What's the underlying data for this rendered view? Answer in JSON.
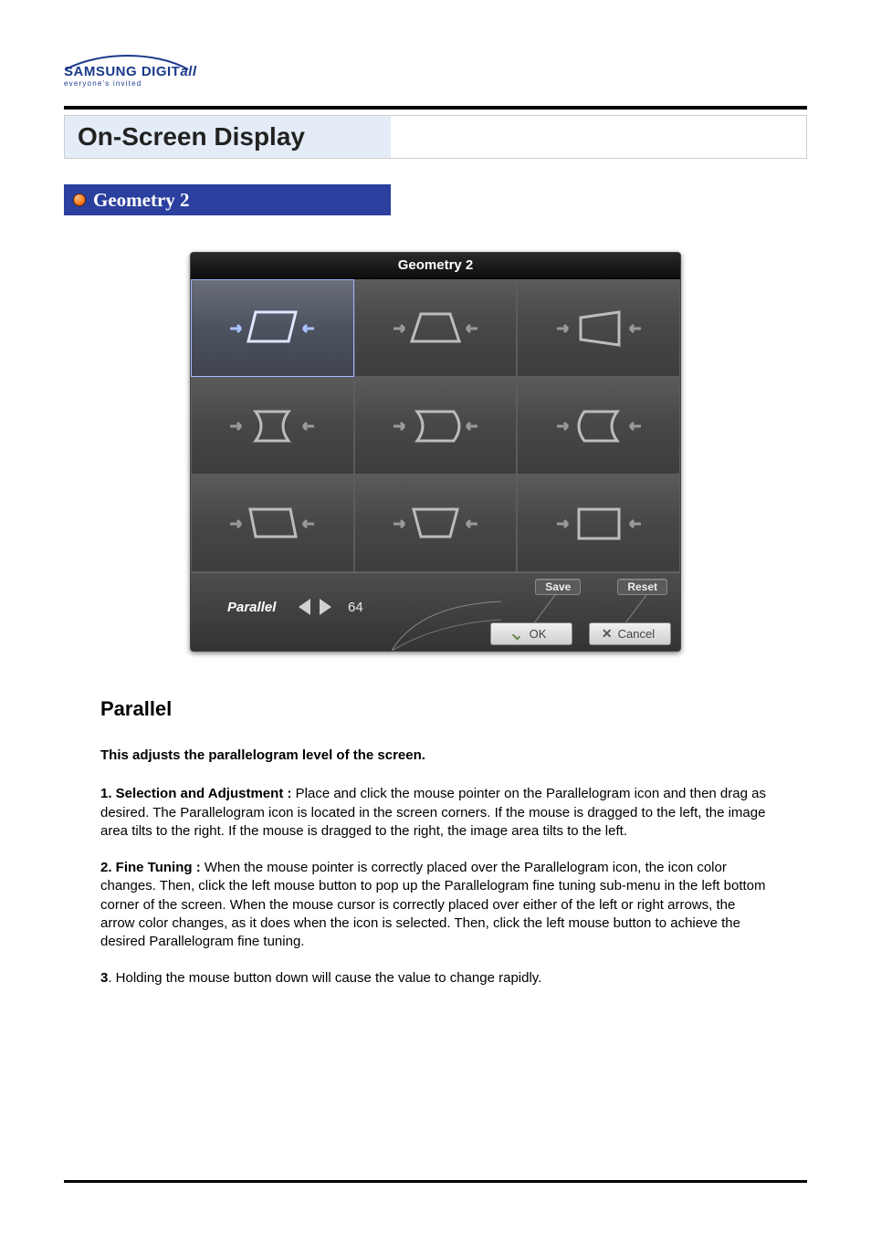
{
  "logo": {
    "brand_main": "SAMSUNG DIGIT",
    "brand_suffix": "all",
    "tagline": "everyone's invited"
  },
  "section_title": "On-Screen Display",
  "subsection_title": "Geometry 2",
  "osd": {
    "title": "Geometry 2",
    "adjust_name": "Parallel",
    "adjust_value": "64",
    "save_label": "Save",
    "reset_label": "Reset",
    "ok_label": "OK",
    "cancel_label": "Cancel"
  },
  "article": {
    "heading": "Parallel",
    "lead": "This adjusts the parallelogram level of the screen.",
    "step1_label": "1. Selection and Adjustment : ",
    "step1_text": "Place and click the mouse pointer on the Parallelogram icon and then drag as desired. The Parallelogram icon is located in the screen corners. If the mouse is dragged to the left, the image area tilts to the right. If the mouse is dragged to the right, the image area tilts to the left.",
    "step2_label": "2. Fine Tuning : ",
    "step2_text": "When the mouse pointer is correctly placed over the Parallelogram icon, the icon color changes. Then, click the left mouse button to pop up the Parallelogram fine tuning sub-menu in the left bottom corner of the screen. When the mouse cursor is correctly placed over either of the left or right arrows, the arrow color changes, as it does when the icon is selected. Then, click the left mouse button to achieve the desired Parallelogram fine tuning.",
    "step3_label": "3",
    "step3_text": ". Holding the mouse button down will cause the value to change rapidly."
  }
}
